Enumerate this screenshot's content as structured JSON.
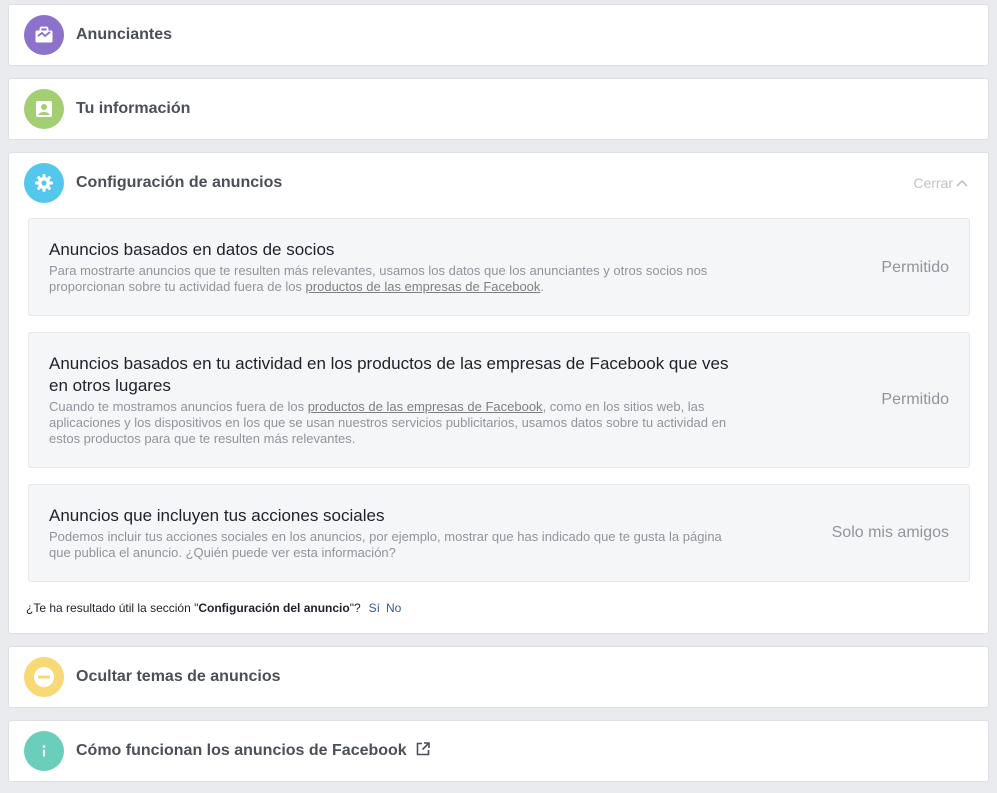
{
  "sections": {
    "advertisers": {
      "label": "Anunciantes",
      "icon": "briefcase-icon",
      "color": "#8c72cb"
    },
    "your_info": {
      "label": "Tu información",
      "icon": "person-card-icon",
      "color": "#a3ce71"
    },
    "ad_settings": {
      "label": "Configuración de anuncios",
      "icon": "gear-icon",
      "color": "#54c7ec",
      "close_label": "Cerrar",
      "items": [
        {
          "title": "Anuncios basados en datos de socios",
          "desc_before": "Para mostrarte anuncios que te resulten más relevantes, usamos los datos que los anunciantes y otros socios nos proporcionan sobre tu actividad fuera de los ",
          "desc_link": "productos de las empresas de Facebook",
          "desc_after": ".",
          "value": "Permitido"
        },
        {
          "title": "Anuncios basados en tu actividad en los productos de las empresas de Facebook que ves en otros lugares",
          "desc_before": "Cuando te mostramos anuncios fuera de los ",
          "desc_link": "productos de las empresas de Facebook",
          "desc_after": ", como en los sitios web, las aplicaciones y los dispositivos en los que se usan nuestros servicios publicitarios, usamos datos sobre tu actividad en estos productos para que te resulten más relevantes.",
          "value": "Permitido"
        },
        {
          "title": "Anuncios que incluyen tus acciones sociales",
          "desc_before": "Podemos incluir tus acciones sociales en los anuncios, por ejemplo, mostrar que has indicado que te gusta la página que publica el anuncio. ¿Quién puede ver esta información?",
          "desc_link": "",
          "desc_after": "",
          "value": "Solo mis amigos"
        }
      ],
      "feedback": {
        "question_before": "¿Te ha resultado útil la sección \"",
        "question_bold": "Configuración del anuncio",
        "question_after": "\"?",
        "yes": "Sí",
        "no": "No"
      }
    },
    "hide_topics": {
      "label": "Ocultar temas de anuncios",
      "icon": "minus-circle-icon",
      "color": "#f7d975"
    },
    "how_ads_work": {
      "label": "Cómo funcionan los anuncios de Facebook",
      "icon": "info-icon",
      "color": "#6bcebb",
      "external_icon": "external-link-icon"
    }
  }
}
